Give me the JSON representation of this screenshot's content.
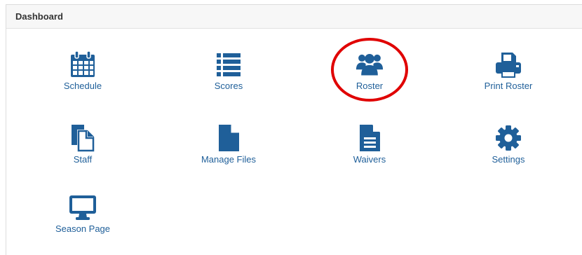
{
  "dashboard": {
    "title": "Dashboard",
    "accent_color": "#1f5f99",
    "highlight_color": "#e00000",
    "tiles": [
      {
        "label": "Schedule",
        "icon": "calendar-icon"
      },
      {
        "label": "Scores",
        "icon": "list-icon"
      },
      {
        "label": "Roster",
        "icon": "users-icon"
      },
      {
        "label": "Print Roster",
        "icon": "printer-icon"
      },
      {
        "label": "Staff",
        "icon": "copy-icon"
      },
      {
        "label": "Manage Files",
        "icon": "file-icon"
      },
      {
        "label": "Waivers",
        "icon": "file-text-icon"
      },
      {
        "label": "Settings",
        "icon": "gear-icon"
      },
      {
        "label": "Season Page",
        "icon": "desktop-icon"
      }
    ]
  }
}
